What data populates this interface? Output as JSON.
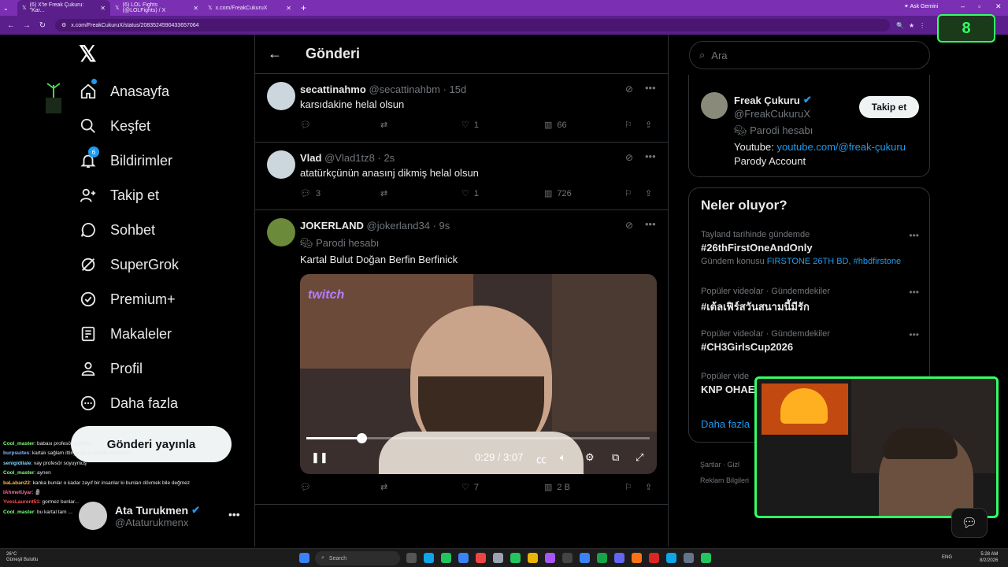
{
  "browser": {
    "tabs": [
      {
        "label": "(6) X'te Freak Çukuru: \"Kar...",
        "active": true
      },
      {
        "label": "(6) LOL Fights (@LOLFights) / X",
        "active": false
      },
      {
        "label": "x.com/FreakCukuruX",
        "active": false
      }
    ],
    "ask_gemini": "Ask Gemini",
    "url": "x.com/FreakCukuruX/status/2083524590433657064"
  },
  "counter_overlay": "8",
  "nav": {
    "items": [
      {
        "label": "Anasayfa",
        "icon": "home-icon"
      },
      {
        "label": "Keşfet",
        "icon": "search-icon"
      },
      {
        "label": "Bildirimler",
        "icon": "bell-icon",
        "badge": "6"
      },
      {
        "label": "Takip et",
        "icon": "person-add-icon"
      },
      {
        "label": "Sohbet",
        "icon": "chat-bubble-icon"
      },
      {
        "label": "SuperGrok",
        "icon": "grok-icon"
      },
      {
        "label": "Premium+",
        "icon": "verified-badge-icon"
      },
      {
        "label": "Makaleler",
        "icon": "article-icon"
      },
      {
        "label": "Profil",
        "icon": "person-icon"
      },
      {
        "label": "Daha fazla",
        "icon": "more-circle-icon"
      }
    ],
    "post_button": "Gönderi yayınla",
    "account": {
      "name": "Ata Turukmen",
      "handle": "@Ataturukmenx"
    }
  },
  "chat": [
    {
      "user": "Cool_master",
      "color": "#7cff7c",
      "text": "babası profesör u konti..."
    },
    {
      "user": "burpsuites",
      "color": "#8ab4ff",
      "text": "kartalı sağlam ittiriyorlar ki nittuda söyleşilim"
    },
    {
      "user": "senigidilale",
      "color": "#7cd4ff",
      "text": "vay profesör soyuymuş"
    },
    {
      "user": "Cool_master",
      "color": "#7cff7c",
      "text": "aynen"
    },
    {
      "user": "baLaban22",
      "color": "#ffb347",
      "text": "kanka bunlar o kadar zayıf bir insanlar ki bunları dövmek bile değmez"
    },
    {
      "user": "IAhmetUyar",
      "color": "#ff6b9a",
      "text": "🗿"
    },
    {
      "user": "YvesLaurent51",
      "color": "#ff4d4d",
      "text": "gormez bunlar..."
    },
    {
      "user": "Cool_master",
      "color": "#7cff7c",
      "text": "bu kartal tam ..."
    }
  ],
  "header": {
    "title": "Gönderi"
  },
  "replies": [
    {
      "name": "secattinahmo",
      "handle": "@secattinahbm",
      "time": "15d",
      "text": "karsıdakine helal olsun",
      "replies": "",
      "reposts": "",
      "likes": "1",
      "views": "66"
    },
    {
      "name": "Vlad",
      "handle": "@Vlad1tz8",
      "time": "2s",
      "text": "atatürkçünün anasınj dikmiş helal olsun",
      "replies": "3",
      "reposts": "",
      "likes": "1",
      "views": "726"
    },
    {
      "name": "JOKERLAND",
      "handle": "@jokerland34",
      "time": "9s",
      "parody": "Parodi hesabı",
      "text": "Kartal Bulut Doğan Berfin Berfinick",
      "replies": "",
      "reposts": "",
      "likes": "7",
      "views": "2 B"
    }
  ],
  "video": {
    "overlay_logo": "twitch",
    "time": "0:29 / 3:07",
    "progress": 0.16
  },
  "right": {
    "search_placeholder": "Ara",
    "profile": {
      "name": "Freak Çukuru",
      "handle": "@FreakCukuruX",
      "parody": "Parodi hesabı",
      "bio_prefix": "Youtube: ",
      "bio_link": "youtube.com/@freak-çukuru",
      "bio2": "Parody Account",
      "follow_button": "Takip et"
    },
    "trends_title": "Neler oluyor?",
    "trends": [
      {
        "context": "Tayland tarihinde gündemde",
        "title": "#26thFirstOneAndOnly",
        "extra_prefix": "Gündem konusu ",
        "extra_links": "FIRSTONE 26TH BD, #hbdfirstone"
      },
      {
        "context": "Popüler videolar · Gündemdekiler",
        "title": "#เต้ลเฟิร์สวันสนามนี้มีรัก",
        "extra_prefix": "",
        "extra_links": ""
      },
      {
        "context": "Popüler videolar · Gündemdekiler",
        "title": "#CH3GirlsCup2026",
        "extra_prefix": "",
        "extra_links": ""
      },
      {
        "context": "Popüler vide",
        "title": "KNP OHAE",
        "extra_prefix": "",
        "extra_links": ""
      }
    ],
    "show_more": "Daha fazla",
    "footer_line1": "Şartlar  ·  Gizl",
    "footer_line2": "Reklam Bilgileri"
  },
  "taskbar": {
    "weather_temp": "26°C",
    "weather_desc": "Güneşli Bulutlu",
    "search_label": "Search",
    "lang": "ENG",
    "time": "5:28 AM",
    "date": "8/2/2026"
  }
}
